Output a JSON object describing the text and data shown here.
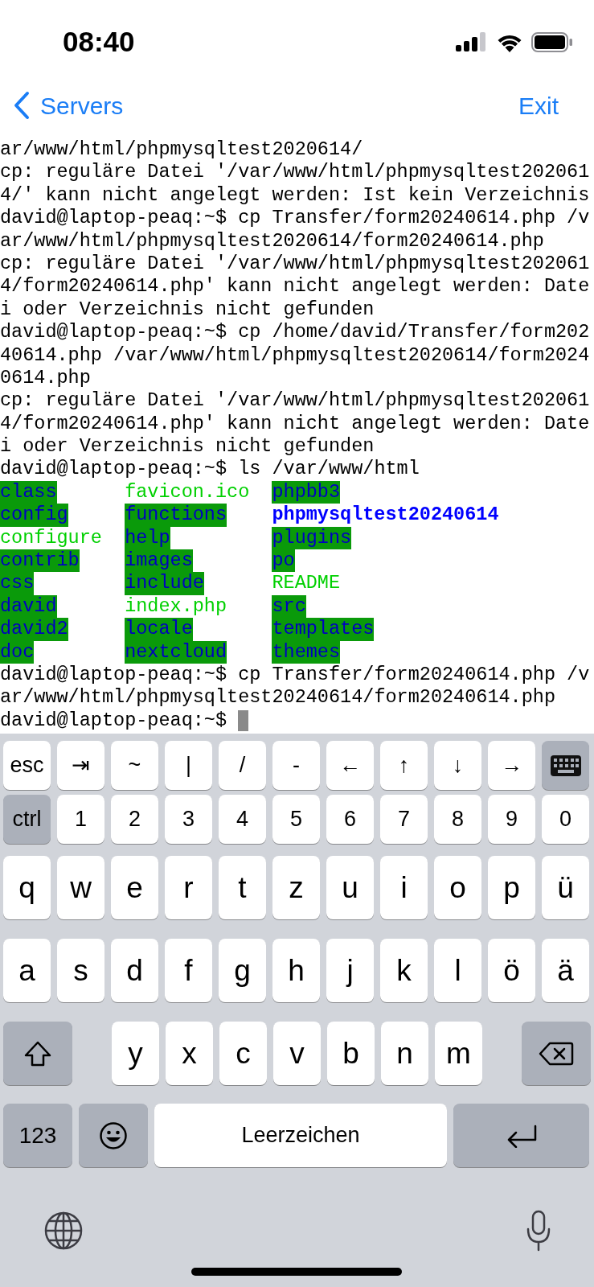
{
  "status_bar": {
    "time": "08:40"
  },
  "nav": {
    "back_label": "Servers",
    "action": "Exit"
  },
  "terminal": {
    "lines_before": [
      "ar/www/html/phpmysqltest2020614/",
      "cp: reguläre Datei '/var/www/html/phpmysqltest202061",
      "4/' kann nicht angelegt werden: Ist kein Verzeichnis",
      "david@laptop-peaq:~$ cp Transfer/form20240614.php /v",
      "ar/www/html/phpmysqltest2020614/form20240614.php",
      "cp: reguläre Datei '/var/www/html/phpmysqltest202061",
      "4/form20240614.php' kann nicht angelegt werden: Date",
      "i oder Verzeichnis nicht gefunden",
      "david@laptop-peaq:~$ cp /home/david/Transfer/form202",
      "40614.php /var/www/html/phpmysqltest2020614/form2024",
      "0614.php",
      "cp: reguläre Datei '/var/www/html/phpmysqltest202061",
      "4/form20240614.php' kann nicht angelegt werden: Date",
      "i oder Verzeichnis nicht gefunden",
      "david@laptop-peaq:~$ ls /var/www/html"
    ],
    "listing": [
      [
        {
          "text": "class",
          "kind": "sticky_dir"
        },
        {
          "text": "favicon.ico",
          "kind": "executable"
        },
        {
          "text": "phpbb3",
          "kind": "sticky_dir"
        }
      ],
      [
        {
          "text": "config",
          "kind": "sticky_dir"
        },
        {
          "text": "functions",
          "kind": "sticky_dir"
        },
        {
          "text": "phpmysqltest20240614",
          "kind": "directory"
        }
      ],
      [
        {
          "text": "configure",
          "kind": "executable"
        },
        {
          "text": "help",
          "kind": "sticky_dir"
        },
        {
          "text": "plugins",
          "kind": "sticky_dir"
        }
      ],
      [
        {
          "text": "contrib",
          "kind": "sticky_dir"
        },
        {
          "text": "images",
          "kind": "sticky_dir"
        },
        {
          "text": "po",
          "kind": "sticky_dir"
        }
      ],
      [
        {
          "text": "css",
          "kind": "sticky_dir"
        },
        {
          "text": "include",
          "kind": "sticky_dir"
        },
        {
          "text": "README",
          "kind": "executable"
        }
      ],
      [
        {
          "text": "david",
          "kind": "sticky_dir"
        },
        {
          "text": "index.php",
          "kind": "executable"
        },
        {
          "text": "src",
          "kind": "sticky_dir"
        }
      ],
      [
        {
          "text": "david2",
          "kind": "sticky_dir"
        },
        {
          "text": "locale",
          "kind": "sticky_dir"
        },
        {
          "text": "templates",
          "kind": "sticky_dir"
        }
      ],
      [
        {
          "text": "doc",
          "kind": "sticky_dir"
        },
        {
          "text": "nextcloud",
          "kind": "sticky_dir"
        },
        {
          "text": "themes",
          "kind": "sticky_dir"
        }
      ]
    ],
    "lines_after": [
      "david@laptop-peaq:~$ cp Transfer/form20240614.php /v",
      "ar/www/html/phpmysqltest20240614/form20240614.php"
    ],
    "prompt": "david@laptop-peaq:~$"
  },
  "keyboard": {
    "accessory_keys": [
      {
        "label": "esc",
        "kind": "key"
      },
      {
        "label": "⇥",
        "kind": "key"
      },
      {
        "label": "~",
        "kind": "key"
      },
      {
        "label": "|",
        "kind": "key"
      },
      {
        "label": "/",
        "kind": "key"
      },
      {
        "label": "-",
        "kind": "key"
      },
      {
        "label": "←",
        "kind": "key"
      },
      {
        "label": "↑",
        "kind": "key"
      },
      {
        "label": "↓",
        "kind": "key"
      },
      {
        "label": "→",
        "kind": "key"
      },
      {
        "kind": "keyboard_toggle"
      }
    ],
    "number_keys": [
      {
        "label": "ctrl",
        "kind": "modifier"
      },
      {
        "label": "1",
        "kind": "key"
      },
      {
        "label": "2",
        "kind": "key"
      },
      {
        "label": "3",
        "kind": "key"
      },
      {
        "label": "4",
        "kind": "key"
      },
      {
        "label": "5",
        "kind": "key"
      },
      {
        "label": "6",
        "kind": "key"
      },
      {
        "label": "7",
        "kind": "key"
      },
      {
        "label": "8",
        "kind": "key"
      },
      {
        "label": "9",
        "kind": "key"
      },
      {
        "label": "0",
        "kind": "key"
      }
    ],
    "letter_rows": [
      [
        "q",
        "w",
        "e",
        "r",
        "t",
        "z",
        "u",
        "i",
        "o",
        "p",
        "ü"
      ],
      [
        "a",
        "s",
        "d",
        "f",
        "g",
        "h",
        "j",
        "k",
        "l",
        "ö",
        "ä"
      ],
      [
        "y",
        "x",
        "c",
        "v",
        "b",
        "n",
        "m"
      ]
    ],
    "numbers_key": "123",
    "space_key": "Leerzeichen"
  }
}
